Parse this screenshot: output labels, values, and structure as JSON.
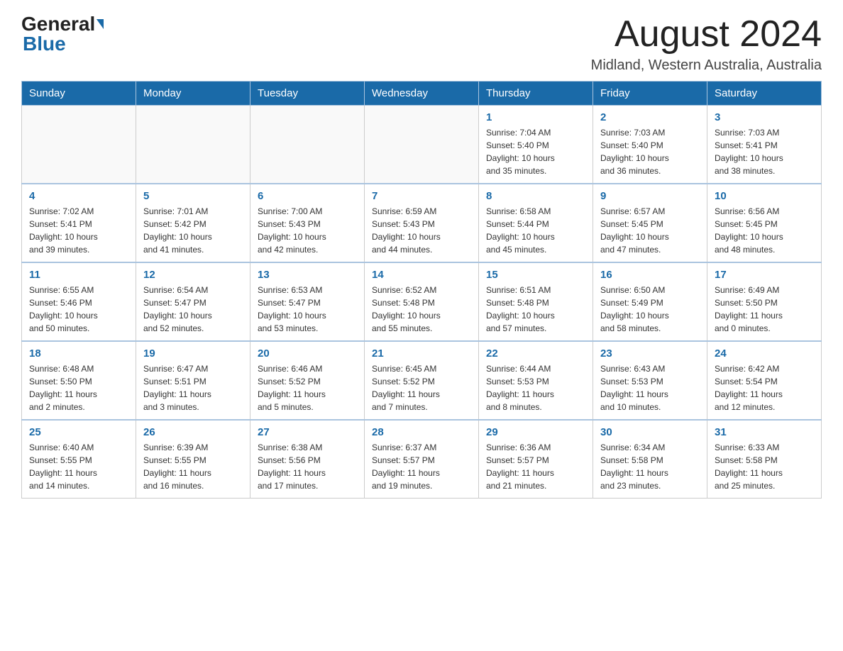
{
  "header": {
    "logo_text_main": "General",
    "logo_text_blue": "Blue",
    "month_title": "August 2024",
    "location": "Midland, Western Australia, Australia"
  },
  "days_of_week": [
    "Sunday",
    "Monday",
    "Tuesday",
    "Wednesday",
    "Thursday",
    "Friday",
    "Saturday"
  ],
  "weeks": [
    [
      {
        "num": "",
        "info": ""
      },
      {
        "num": "",
        "info": ""
      },
      {
        "num": "",
        "info": ""
      },
      {
        "num": "",
        "info": ""
      },
      {
        "num": "1",
        "info": "Sunrise: 7:04 AM\nSunset: 5:40 PM\nDaylight: 10 hours\nand 35 minutes."
      },
      {
        "num": "2",
        "info": "Sunrise: 7:03 AM\nSunset: 5:40 PM\nDaylight: 10 hours\nand 36 minutes."
      },
      {
        "num": "3",
        "info": "Sunrise: 7:03 AM\nSunset: 5:41 PM\nDaylight: 10 hours\nand 38 minutes."
      }
    ],
    [
      {
        "num": "4",
        "info": "Sunrise: 7:02 AM\nSunset: 5:41 PM\nDaylight: 10 hours\nand 39 minutes."
      },
      {
        "num": "5",
        "info": "Sunrise: 7:01 AM\nSunset: 5:42 PM\nDaylight: 10 hours\nand 41 minutes."
      },
      {
        "num": "6",
        "info": "Sunrise: 7:00 AM\nSunset: 5:43 PM\nDaylight: 10 hours\nand 42 minutes."
      },
      {
        "num": "7",
        "info": "Sunrise: 6:59 AM\nSunset: 5:43 PM\nDaylight: 10 hours\nand 44 minutes."
      },
      {
        "num": "8",
        "info": "Sunrise: 6:58 AM\nSunset: 5:44 PM\nDaylight: 10 hours\nand 45 minutes."
      },
      {
        "num": "9",
        "info": "Sunrise: 6:57 AM\nSunset: 5:45 PM\nDaylight: 10 hours\nand 47 minutes."
      },
      {
        "num": "10",
        "info": "Sunrise: 6:56 AM\nSunset: 5:45 PM\nDaylight: 10 hours\nand 48 minutes."
      }
    ],
    [
      {
        "num": "11",
        "info": "Sunrise: 6:55 AM\nSunset: 5:46 PM\nDaylight: 10 hours\nand 50 minutes."
      },
      {
        "num": "12",
        "info": "Sunrise: 6:54 AM\nSunset: 5:47 PM\nDaylight: 10 hours\nand 52 minutes."
      },
      {
        "num": "13",
        "info": "Sunrise: 6:53 AM\nSunset: 5:47 PM\nDaylight: 10 hours\nand 53 minutes."
      },
      {
        "num": "14",
        "info": "Sunrise: 6:52 AM\nSunset: 5:48 PM\nDaylight: 10 hours\nand 55 minutes."
      },
      {
        "num": "15",
        "info": "Sunrise: 6:51 AM\nSunset: 5:48 PM\nDaylight: 10 hours\nand 57 minutes."
      },
      {
        "num": "16",
        "info": "Sunrise: 6:50 AM\nSunset: 5:49 PM\nDaylight: 10 hours\nand 58 minutes."
      },
      {
        "num": "17",
        "info": "Sunrise: 6:49 AM\nSunset: 5:50 PM\nDaylight: 11 hours\nand 0 minutes."
      }
    ],
    [
      {
        "num": "18",
        "info": "Sunrise: 6:48 AM\nSunset: 5:50 PM\nDaylight: 11 hours\nand 2 minutes."
      },
      {
        "num": "19",
        "info": "Sunrise: 6:47 AM\nSunset: 5:51 PM\nDaylight: 11 hours\nand 3 minutes."
      },
      {
        "num": "20",
        "info": "Sunrise: 6:46 AM\nSunset: 5:52 PM\nDaylight: 11 hours\nand 5 minutes."
      },
      {
        "num": "21",
        "info": "Sunrise: 6:45 AM\nSunset: 5:52 PM\nDaylight: 11 hours\nand 7 minutes."
      },
      {
        "num": "22",
        "info": "Sunrise: 6:44 AM\nSunset: 5:53 PM\nDaylight: 11 hours\nand 8 minutes."
      },
      {
        "num": "23",
        "info": "Sunrise: 6:43 AM\nSunset: 5:53 PM\nDaylight: 11 hours\nand 10 minutes."
      },
      {
        "num": "24",
        "info": "Sunrise: 6:42 AM\nSunset: 5:54 PM\nDaylight: 11 hours\nand 12 minutes."
      }
    ],
    [
      {
        "num": "25",
        "info": "Sunrise: 6:40 AM\nSunset: 5:55 PM\nDaylight: 11 hours\nand 14 minutes."
      },
      {
        "num": "26",
        "info": "Sunrise: 6:39 AM\nSunset: 5:55 PM\nDaylight: 11 hours\nand 16 minutes."
      },
      {
        "num": "27",
        "info": "Sunrise: 6:38 AM\nSunset: 5:56 PM\nDaylight: 11 hours\nand 17 minutes."
      },
      {
        "num": "28",
        "info": "Sunrise: 6:37 AM\nSunset: 5:57 PM\nDaylight: 11 hours\nand 19 minutes."
      },
      {
        "num": "29",
        "info": "Sunrise: 6:36 AM\nSunset: 5:57 PM\nDaylight: 11 hours\nand 21 minutes."
      },
      {
        "num": "30",
        "info": "Sunrise: 6:34 AM\nSunset: 5:58 PM\nDaylight: 11 hours\nand 23 minutes."
      },
      {
        "num": "31",
        "info": "Sunrise: 6:33 AM\nSunset: 5:58 PM\nDaylight: 11 hours\nand 25 minutes."
      }
    ]
  ]
}
